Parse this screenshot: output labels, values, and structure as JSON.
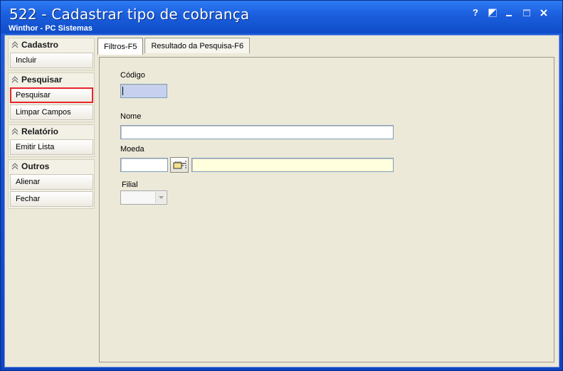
{
  "window": {
    "title": "522 - Cadastrar tipo de cobrança",
    "subtitle": "Winthor - PC Sistemas",
    "controls": {
      "help": "?",
      "restore_icon": "restore-icon",
      "minimize_icon": "minimize-icon",
      "maximize_icon": "maximize-icon",
      "close_icon": "close-icon"
    }
  },
  "sidebar": {
    "groups": [
      {
        "title": "Cadastro",
        "items": [
          {
            "label": "Incluir"
          }
        ]
      },
      {
        "title": "Pesquisar",
        "items": [
          {
            "label": "Pesquisar"
          },
          {
            "label": "Limpar Campos"
          }
        ]
      },
      {
        "title": "Relatório",
        "items": [
          {
            "label": "Emitir Lista"
          }
        ]
      },
      {
        "title": "Outros",
        "items": [
          {
            "label": "Alienar"
          },
          {
            "label": "Fechar"
          }
        ]
      }
    ]
  },
  "tabs": [
    {
      "label": "Filtros-F5"
    },
    {
      "label": "Resultado da Pesquisa-F6"
    }
  ],
  "form": {
    "codigo": {
      "label": "Código",
      "value": ""
    },
    "nome": {
      "label": "Nome",
      "value": ""
    },
    "moeda": {
      "label": "Moeda",
      "code_value": "",
      "description_value": ""
    },
    "filial": {
      "label": "Filial",
      "value": ""
    }
  },
  "colors": {
    "accent": "#1A5EDD",
    "selected_border": "#E8252B",
    "code_field": "#C7D1EF",
    "desc_field": "#FFFFDE"
  }
}
